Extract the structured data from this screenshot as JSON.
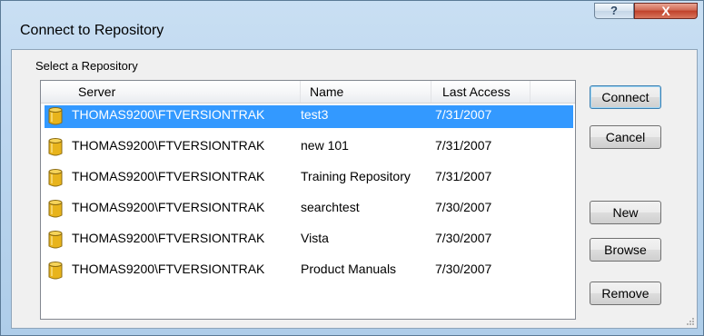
{
  "window": {
    "title": "Connect to Repository",
    "help_glyph": "?",
    "close_glyph": "X"
  },
  "group_label": "Select a Repository",
  "columns": [
    "Server",
    "Name",
    "Last Access"
  ],
  "rows": [
    {
      "server": "THOMAS9200\\FTVERSIONTRAK",
      "name": "test3",
      "last_access": "7/31/2007",
      "selected": true
    },
    {
      "server": "THOMAS9200\\FTVERSIONTRAK",
      "name": "new 101",
      "last_access": "7/31/2007",
      "selected": false
    },
    {
      "server": "THOMAS9200\\FTVERSIONTRAK",
      "name": "Training Repository",
      "last_access": "7/31/2007",
      "selected": false
    },
    {
      "server": "THOMAS9200\\FTVERSIONTRAK",
      "name": "searchtest",
      "last_access": "7/30/2007",
      "selected": false
    },
    {
      "server": "THOMAS9200\\FTVERSIONTRAK",
      "name": "Vista",
      "last_access": "7/30/2007",
      "selected": false
    },
    {
      "server": "THOMAS9200\\FTVERSIONTRAK",
      "name": "Product Manuals",
      "last_access": "7/30/2007",
      "selected": false
    }
  ],
  "buttons": {
    "connect": "Connect",
    "cancel": "Cancel",
    "new": "New",
    "browse": "Browse",
    "remove": "Remove"
  },
  "colors": {
    "selection": "#3399ff",
    "db_icon": "#e8b41c"
  },
  "icons": {
    "row": "database-icon",
    "help": "help-icon",
    "close": "close-icon"
  }
}
